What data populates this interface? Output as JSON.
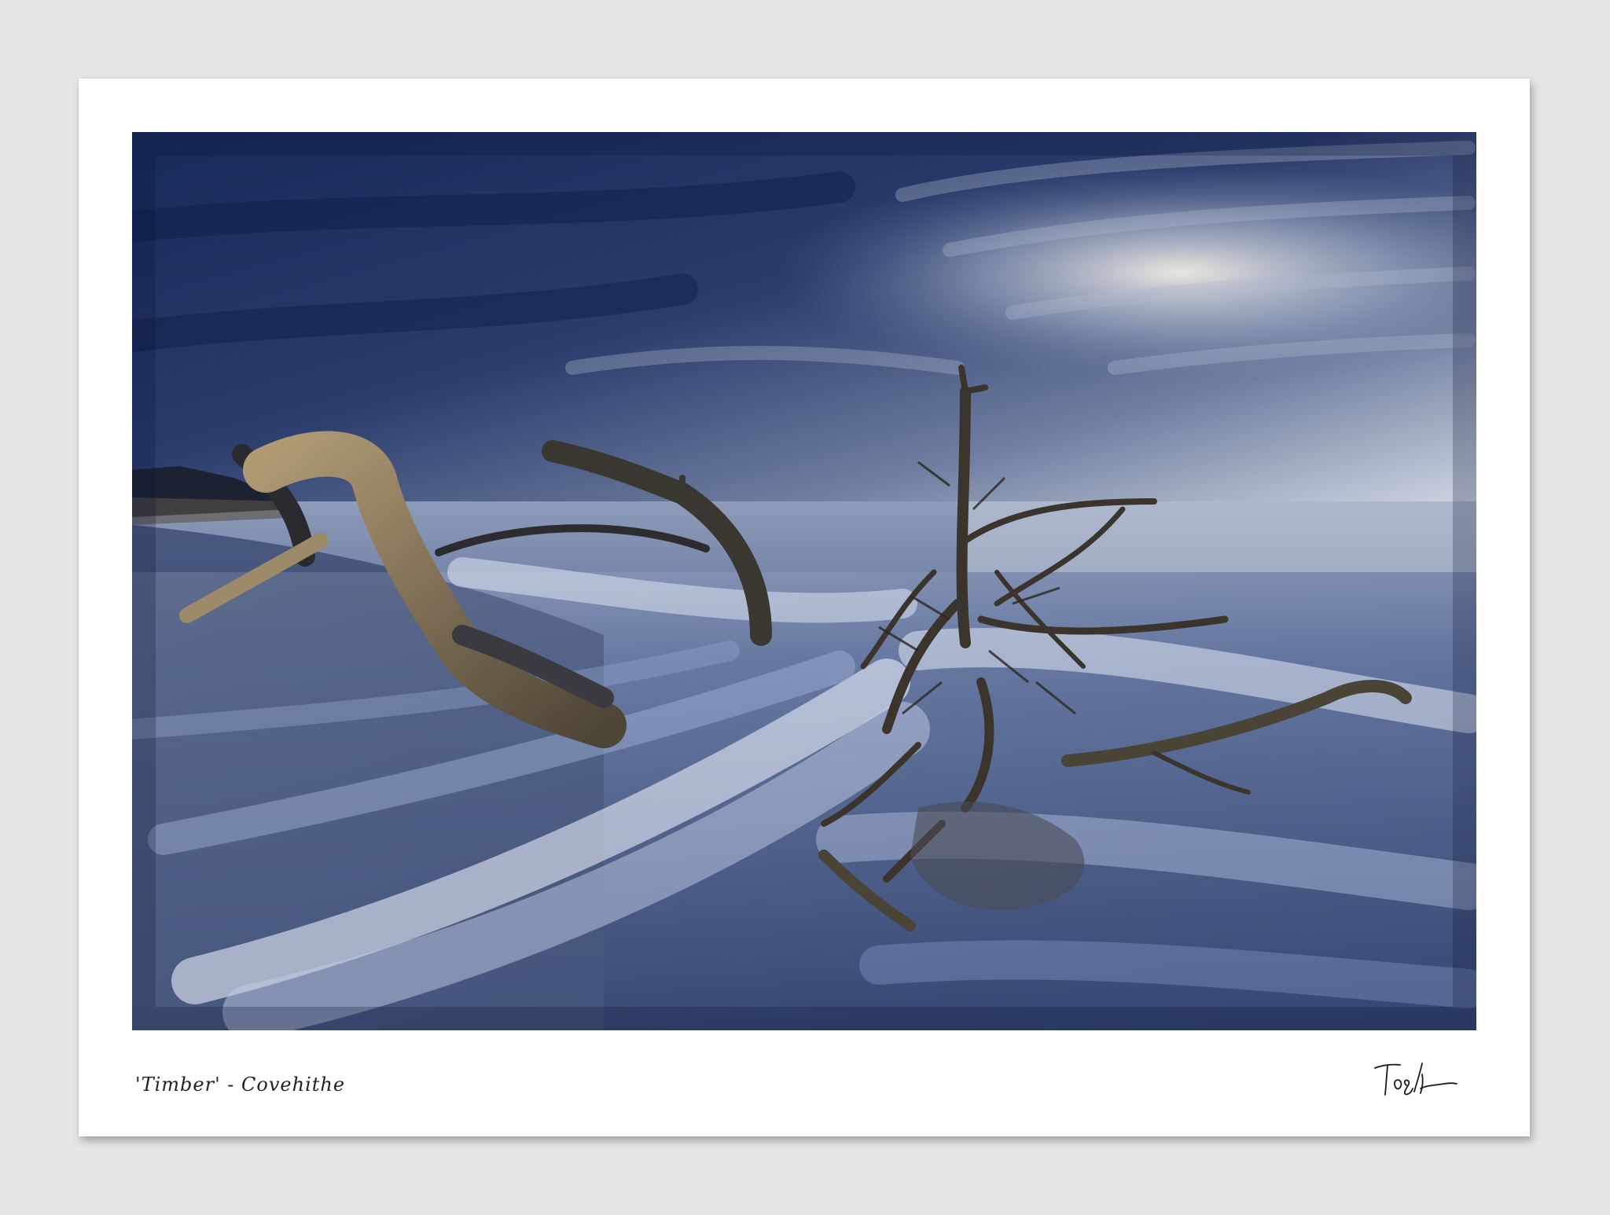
{
  "print": {
    "caption": "'Timber' - Covehithe",
    "signature_icon": "signature-icon",
    "photo_icon": "seascape-photo",
    "colors": {
      "background": "#e6e6e6",
      "paper": "#ffffff",
      "sky_dark": "#1c2f5e",
      "sky_light": "#c9d2df",
      "sea": "#4a5f8c",
      "wood": "#8a7a5e"
    }
  }
}
